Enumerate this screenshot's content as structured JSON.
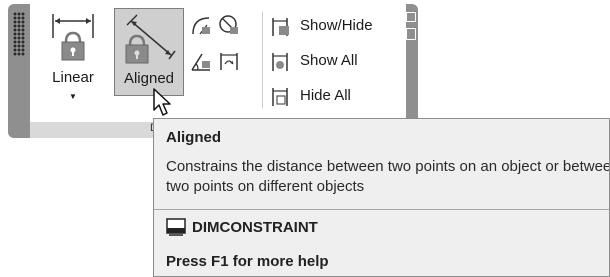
{
  "ribbon": {
    "tools": {
      "linear_label": "Linear",
      "aligned_label": "Aligned"
    },
    "show_hide_label": "Show/Hide",
    "show_all_label": "Show All",
    "hide_all_label": "Hide All",
    "panel_title_visible": "D"
  },
  "tooltip": {
    "title": "Aligned",
    "description": "Constrains the distance between two points on an object or between two points on different objects",
    "command": "DIMCONSTRAINT",
    "help": "Press F1 for more help"
  },
  "icons": {
    "linear": "linear-dimension-lock-icon",
    "aligned": "aligned-dimension-lock-icon",
    "radial": "radial-constraint-icon",
    "diameter": "diameter-constraint-icon",
    "angular": "angular-constraint-icon",
    "convert": "convert-constraint-icon",
    "show_hide": "show-hide-constraint-icon",
    "show_all": "show-all-constraint-icon",
    "hide_all": "hide-all-constraint-icon",
    "command": "command-window-icon",
    "cursor": "mouse-cursor-icon"
  }
}
